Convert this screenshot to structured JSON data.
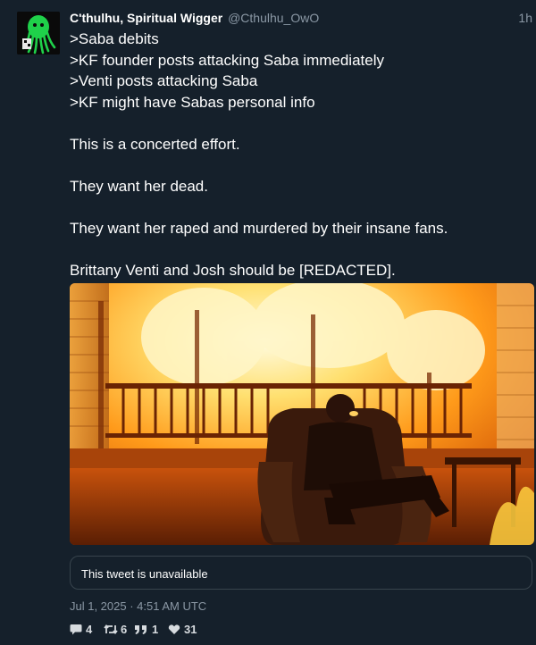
{
  "author": {
    "display_name": "C'thulhu, Spiritual Wigger",
    "handle": "@Cthulhu_OwO",
    "time_ago": "1h"
  },
  "tweet": {
    "lines": [
      ">Saba debits",
      ">KF founder posts attacking Saba immediately",
      ">Venti posts attacking Saba",
      ">KF might have Sabas personal info",
      "This is a concerted effort.",
      "They want her dead.",
      "They want her raped and murdered by their insane fans.",
      "Brittany Venti and Josh should be [REDACTED]."
    ],
    "quoted_tweet": "This tweet is unavailable",
    "date": "Jul 1, 2025 · 4:51 AM UTC"
  },
  "stats": {
    "replies": "4",
    "retweets": "6",
    "quotes": "1",
    "likes": "31"
  },
  "icons": {
    "reply": "comment-icon",
    "retweet": "retweet-icon",
    "quote": "quote-icon",
    "like": "heart-icon"
  },
  "colors": {
    "background": "#15202b",
    "muted_text": "#8b98a5",
    "border": "#38444d",
    "avatar_green": "#1fd14a"
  }
}
